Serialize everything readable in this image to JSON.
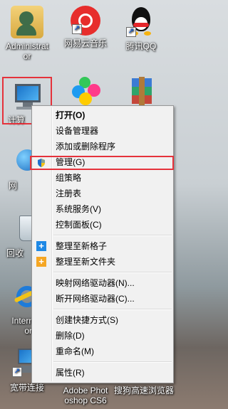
{
  "desktop": {
    "icons": [
      {
        "label": "Administrat\nor",
        "name": "administrator"
      },
      {
        "label": "网易云音乐",
        "name": "netease-music"
      },
      {
        "label": "腾讯QQ",
        "name": "tencent-qq"
      },
      {
        "label": "计算机",
        "name": "computer"
      },
      {
        "label": "",
        "name": "pinwheel"
      },
      {
        "label": "",
        "name": "winrar"
      },
      {
        "label": "网络",
        "name": "network"
      },
      {
        "label": "回收站",
        "name": "recycle-bin"
      },
      {
        "label": "Internet Explorer",
        "name": "internet-explorer"
      },
      {
        "label": "宽带连接",
        "name": "broadband"
      },
      {
        "label": "Adobe Photoshop CS6",
        "name": "photoshop"
      },
      {
        "label": "搜狗高速浏览器",
        "name": "sogou-browser"
      }
    ],
    "visible_labels": {
      "admin_1": "Administrat",
      "admin_2": "or",
      "netease": "网易云音乐",
      "qq": "腾讯QQ",
      "computer": "计算",
      "network": "网",
      "recycle": "回收",
      "ie_1": "Interne",
      "ie_2": "ore",
      "broadband": "宽带连接",
      "ps_1": "Adobe Phot",
      "ps_2": "oshop CS6",
      "sogou": "搜狗高速浏览器"
    }
  },
  "context_menu": {
    "items": [
      {
        "label": "打开(O)",
        "bold": true
      },
      {
        "label": "设备管理器"
      },
      {
        "label": "添加或删除程序"
      },
      {
        "label": "管理(G)",
        "icon": "shield-icon"
      },
      {
        "label": "组策略"
      },
      {
        "label": "注册表"
      },
      {
        "label": "系统服务(V)"
      },
      {
        "label": "控制面板(C)"
      },
      {
        "label": "整理至新格子",
        "icon": "plus-blue-icon"
      },
      {
        "label": "整理至新文件夹",
        "icon": "plus-orange-icon"
      },
      {
        "label": "映射网络驱动器(N)..."
      },
      {
        "label": "断开网络驱动器(C)..."
      },
      {
        "label": "创建快捷方式(S)"
      },
      {
        "label": "删除(D)"
      },
      {
        "label": "重命名(M)"
      },
      {
        "label": "属性(R)"
      }
    ]
  },
  "colors": {
    "highlight": "#e5323b",
    "menu_bg": "#f1f1f1",
    "plus_blue": "#1e88e5",
    "plus_orange": "#f5a623"
  }
}
